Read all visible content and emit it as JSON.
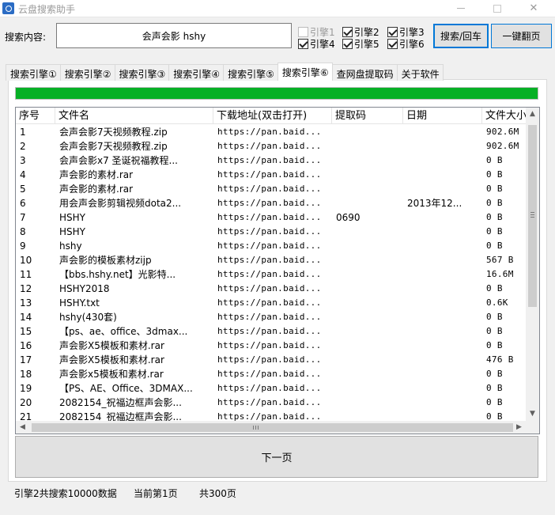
{
  "window": {
    "title": "云盘搜索助手"
  },
  "search": {
    "label": "搜索内容:",
    "value": "会声会影 hshy"
  },
  "engines": [
    {
      "label": "引擎1",
      "checked": false,
      "enabled": false
    },
    {
      "label": "引擎2",
      "checked": true,
      "enabled": true
    },
    {
      "label": "引擎3",
      "checked": true,
      "enabled": true
    },
    {
      "label": "引擎4",
      "checked": true,
      "enabled": true
    },
    {
      "label": "引擎5",
      "checked": true,
      "enabled": true
    },
    {
      "label": "引擎6",
      "checked": true,
      "enabled": true
    }
  ],
  "buttons": {
    "search": "搜索/回车",
    "flip": "一键翻页",
    "next_page": "下一页"
  },
  "tabs": [
    "搜索引擎①",
    "搜索引擎②",
    "搜索引擎③",
    "搜索引擎④",
    "搜索引擎⑤",
    "搜索引擎⑥",
    "查网盘提取码",
    "关于软件"
  ],
  "active_tab": 5,
  "progress": {
    "value_percent": 100,
    "color": "#06b025"
  },
  "table": {
    "columns": [
      "序号",
      "文件名",
      "下载地址(双击打开)",
      "提取码",
      "日期",
      "文件大小"
    ],
    "rows": [
      [
        "1",
        "会声会影7天视频教程.zip",
        "https://pan.baid...",
        "",
        "",
        "902.6M"
      ],
      [
        "2",
        "会声会影7天视频教程.zip",
        "https://pan.baid...",
        "",
        "",
        "902.6M"
      ],
      [
        "3",
        "会声会影x7 圣诞祝福教程...",
        "https://pan.baid...",
        "",
        "",
        "0 B"
      ],
      [
        "4",
        "声会影的素材.rar",
        "https://pan.baid...",
        "",
        "",
        "0 B"
      ],
      [
        "5",
        "声会影的素材.rar",
        "https://pan.baid...",
        "",
        "",
        "0 B"
      ],
      [
        "6",
        "用会声会影剪辑视频dota2...",
        "https://pan.baid...",
        "",
        "2013年12...",
        "0 B"
      ],
      [
        "7",
        "HSHY",
        "https://pan.baid...",
        "0690",
        "",
        "0 B"
      ],
      [
        "8",
        "HSHY",
        "https://pan.baid...",
        "",
        "",
        "0 B"
      ],
      [
        "9",
        "hshy",
        "https://pan.baid...",
        "",
        "",
        "0 B"
      ],
      [
        "10",
        "声会影的模板素材zijp",
        "https://pan.baid...",
        "",
        "",
        "567 B"
      ],
      [
        "11",
        "【bbs.hshy.net】光影特...",
        "https://pan.baid...",
        "",
        "",
        "16.6M"
      ],
      [
        "12",
        "HSHY2018",
        "https://pan.baid...",
        "",
        "",
        "0 B"
      ],
      [
        "13",
        "HSHY.txt",
        "https://pan.baid...",
        "",
        "",
        "0.6K"
      ],
      [
        "14",
        "hshy(430套)",
        "https://pan.baid...",
        "",
        "",
        "0 B"
      ],
      [
        "15",
        "【ps、ae、office、3dmax...",
        "https://pan.baid...",
        "",
        "",
        "0 B"
      ],
      [
        "16",
        "声会影X5模板和素材.rar",
        "https://pan.baid...",
        "",
        "",
        "0 B"
      ],
      [
        "17",
        "声会影X5模板和素材.rar",
        "https://pan.baid...",
        "",
        "",
        "476 B"
      ],
      [
        "18",
        "声会影x5模板和素材.rar",
        "https://pan.baid...",
        "",
        "",
        "0 B"
      ],
      [
        "19",
        "【PS、AE、Office、3DMAX...",
        "https://pan.baid...",
        "",
        "",
        "0 B"
      ],
      [
        "20",
        "2082154_祝福边框声会影...",
        "https://pan.baid...",
        "",
        "",
        "0 B"
      ],
      [
        "21",
        "2082154_祝福边框声会影...",
        "https://pan.baid...",
        "",
        "",
        "0 B"
      ]
    ]
  },
  "status": {
    "engine_count": "引擎2共搜索10000数据",
    "current_page": "当前第1页",
    "total_pages": "共300页"
  }
}
